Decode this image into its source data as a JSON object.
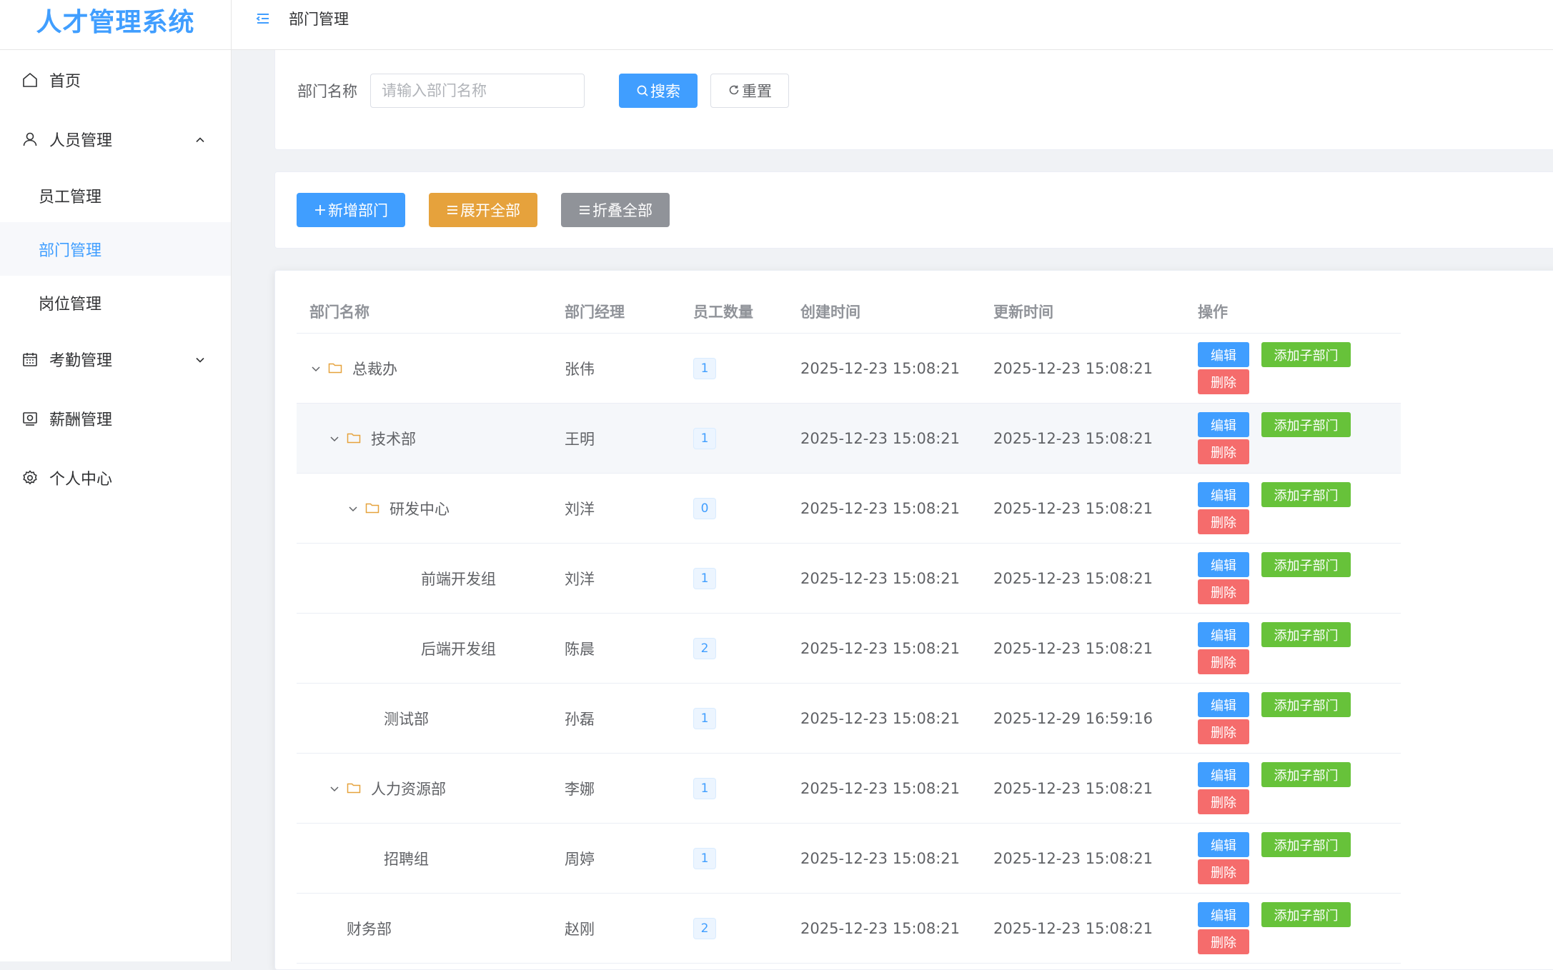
{
  "app": {
    "title": "人才管理系统"
  },
  "sidebar": {
    "items": [
      {
        "label": "首页",
        "icon": "home-icon"
      },
      {
        "label": "人员管理",
        "icon": "user-icon",
        "expanded": true,
        "children": [
          "员工管理",
          "部门管理",
          "岗位管理"
        ],
        "active_child": "部门管理"
      },
      {
        "label": "考勤管理",
        "icon": "calendar-icon",
        "expanded": false
      },
      {
        "label": "薪酬管理",
        "icon": "wallet-icon"
      },
      {
        "label": "个人中心",
        "icon": "gear-icon"
      }
    ]
  },
  "header": {
    "breadcrumb": "部门管理",
    "icon": "fold-icon"
  },
  "search": {
    "label": "部门名称",
    "placeholder": "请输入部门名称",
    "value": "",
    "search_btn": "搜索",
    "reset_btn": "重置"
  },
  "actions": {
    "add": "新增部门",
    "expand": "展开全部",
    "collapse": "折叠全部"
  },
  "table": {
    "headers": [
      "部门名称",
      "部门经理",
      "员工数量",
      "创建时间",
      "更新时间",
      "操作"
    ],
    "op_labels": {
      "edit": "编辑",
      "add_child": "添加子部门",
      "delete": "删除"
    },
    "rows": [
      {
        "name": "总裁办",
        "manager": "张伟",
        "count": "1",
        "created": "2025-12-23 15:08:21",
        "updated": "2025-12-23 15:08:21"
      },
      {
        "name": "技术部",
        "manager": "王明",
        "count": "1",
        "created": "2025-12-23 15:08:21",
        "updated": "2025-12-23 15:08:21"
      },
      {
        "name": "研发中心",
        "manager": "刘洋",
        "count": "0",
        "created": "2025-12-23 15:08:21",
        "updated": "2025-12-23 15:08:21"
      },
      {
        "name": "前端开发组",
        "manager": "刘洋",
        "count": "1",
        "created": "2025-12-23 15:08:21",
        "updated": "2025-12-23 15:08:21"
      },
      {
        "name": "后端开发组",
        "manager": "陈晨",
        "count": "2",
        "created": "2025-12-23 15:08:21",
        "updated": "2025-12-23 15:08:21"
      },
      {
        "name": "测试部",
        "manager": "孙磊",
        "count": "1",
        "created": "2025-12-23 15:08:21",
        "updated": "2025-12-29 16:59:16"
      },
      {
        "name": "人力资源部",
        "manager": "李娜",
        "count": "1",
        "created": "2025-12-23 15:08:21",
        "updated": "2025-12-23 15:08:21"
      },
      {
        "name": "招聘组",
        "manager": "周婷",
        "count": "1",
        "created": "2025-12-23 15:08:21",
        "updated": "2025-12-23 15:08:21"
      },
      {
        "name": "财务部",
        "manager": "赵刚",
        "count": "2",
        "created": "2025-12-23 15:08:21",
        "updated": "2025-12-23 15:08:21"
      }
    ]
  },
  "colors": {
    "primary": "#409eff",
    "success": "#67c23a",
    "warning": "#e6a23c",
    "info": "#909399",
    "danger": "#f56c6c"
  }
}
